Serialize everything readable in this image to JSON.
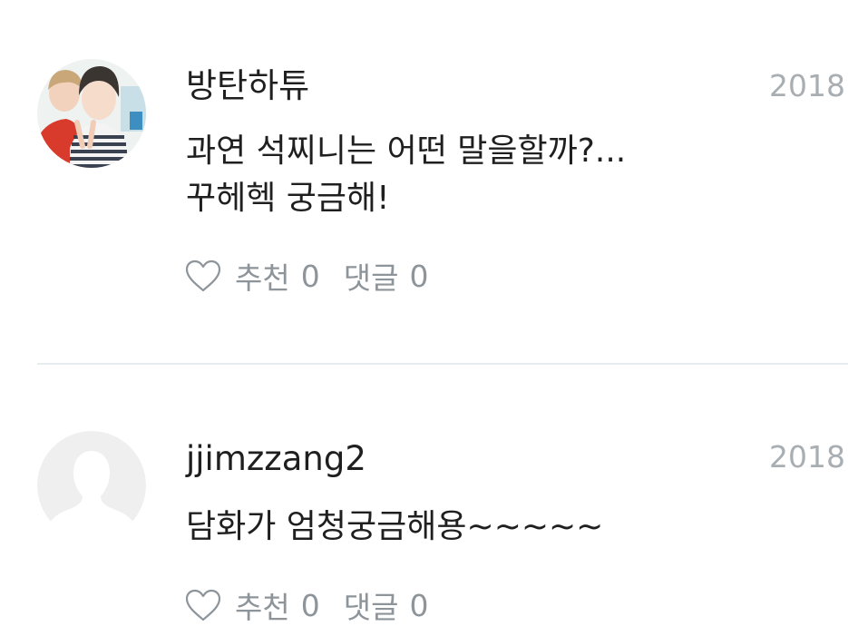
{
  "comments": [
    {
      "author": "방탄하튜",
      "date": "2018.",
      "lines": [
        "과연 석찌니는 어떤 말을할까?...",
        "꾸헤헥 궁금해!"
      ],
      "like_label": "추천",
      "like_count": "0",
      "reply_label": "댓글",
      "reply_count": "0"
    },
    {
      "author": "jjimzzang2",
      "date": "2018.",
      "lines": [
        "담화가 엄청궁금해용~~~~~"
      ],
      "like_label": "추천",
      "like_count": "0",
      "reply_label": "댓글",
      "reply_count": "0"
    }
  ],
  "icons": {
    "like": "heart-outline-icon",
    "default_avatar": "person-silhouette-icon"
  },
  "colors": {
    "text": "#1f1f1f",
    "muted": "#8e959a",
    "date": "#a8aeb2",
    "divider": "#e7ecee",
    "placeholder_avatar_bg": "#efefef"
  }
}
